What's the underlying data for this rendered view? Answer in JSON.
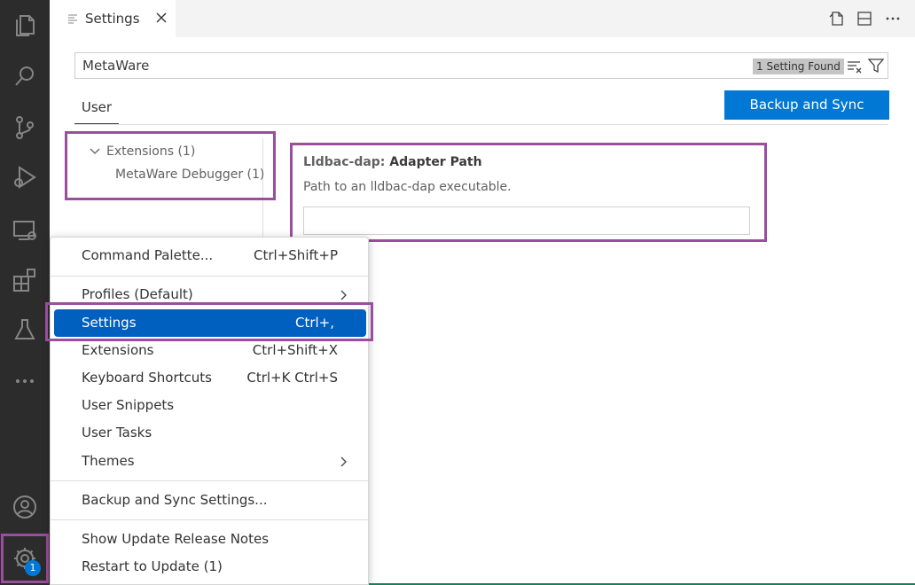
{
  "tab": {
    "title": "Settings"
  },
  "search": {
    "value": "MetaWare",
    "result_count": "1 Setting Found"
  },
  "scope": {
    "user_tab": "User",
    "sync_button": "Backup and Sync Settings"
  },
  "toc": {
    "extensions": "Extensions (1)",
    "debugger": "MetaWare Debugger (1)"
  },
  "setting": {
    "category": "Lldbac-dap: ",
    "name": "Adapter Path",
    "description": "Path to an lldbac-dap executable.",
    "value": ""
  },
  "activity": {
    "manage_badge": "1"
  },
  "menu": {
    "items": [
      {
        "label": "Command Palette...",
        "key": "Ctrl+Shift+P"
      },
      {
        "label": "Profiles (Default)",
        "key": ""
      },
      {
        "label": "Settings",
        "key": "Ctrl+,"
      },
      {
        "label": "Extensions",
        "key": "Ctrl+Shift+X"
      },
      {
        "label": "Keyboard Shortcuts",
        "key": "Ctrl+K Ctrl+S"
      },
      {
        "label": "User Snippets",
        "key": ""
      },
      {
        "label": "User Tasks",
        "key": ""
      },
      {
        "label": "Themes",
        "key": ""
      },
      {
        "label": "Backup and Sync Settings...",
        "key": ""
      },
      {
        "label": "Show Update Release Notes",
        "key": ""
      },
      {
        "label": "Restart to Update (1)",
        "key": ""
      }
    ]
  },
  "colors": {
    "accent": "#0078d4",
    "highlight": "#9b4d9e",
    "menu_active": "#0060c0",
    "activity_bar": "#2c2c2c"
  }
}
